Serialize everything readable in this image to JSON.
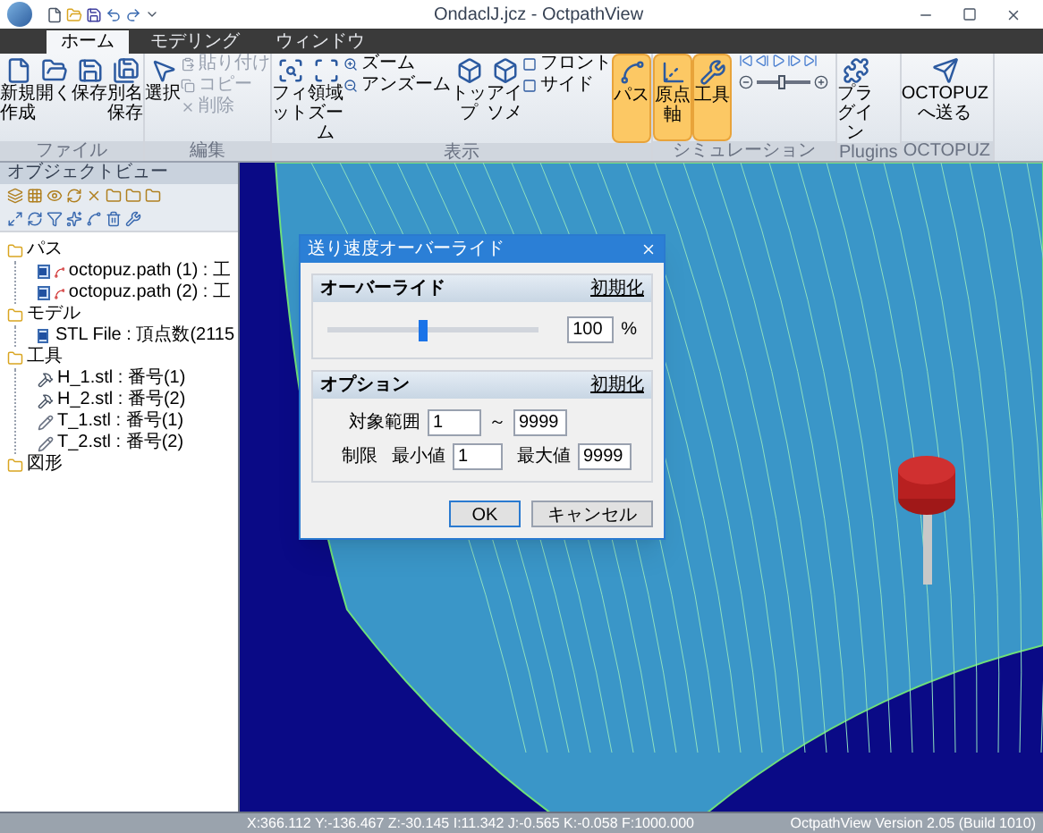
{
  "window": {
    "title": "OndaclJ.jcz - OctpathView"
  },
  "tabs": [
    {
      "label": "ホーム",
      "selected": true
    },
    {
      "label": "モデリング",
      "selected": false
    },
    {
      "label": "ウィンドウ",
      "selected": false
    }
  ],
  "ribbon": {
    "groups": [
      {
        "label": "ファイル",
        "items": [
          {
            "kind": "large",
            "label": "新規作成",
            "on": false
          },
          {
            "kind": "large",
            "label": "開く",
            "on": false
          },
          {
            "kind": "large",
            "label": "保存",
            "on": false
          },
          {
            "kind": "large",
            "label": "別名保存",
            "on": false
          }
        ]
      },
      {
        "label": "編集",
        "items": [
          {
            "kind": "large",
            "label": "選択",
            "on": false
          },
          {
            "kind": "small",
            "label": "貼り付け",
            "disabled": true
          },
          {
            "kind": "small",
            "label": "コピー",
            "disabled": true
          },
          {
            "kind": "small",
            "label": "削除",
            "disabled": true
          }
        ]
      },
      {
        "label": "表示",
        "items": [
          {
            "kind": "large",
            "label": "フィット",
            "on": false
          },
          {
            "kind": "large",
            "label": "領域ズーム",
            "on": false
          },
          {
            "kind": "small",
            "label": "ズーム",
            "disabled": false
          },
          {
            "kind": "small",
            "label": "アンズーム",
            "disabled": false
          },
          {
            "kind": "large",
            "label": "トップ",
            "on": false
          },
          {
            "kind": "large",
            "label": "アイソメ",
            "on": false
          },
          {
            "kind": "small",
            "label": "フロント",
            "disabled": false
          },
          {
            "kind": "small",
            "label": "サイド",
            "disabled": false
          },
          {
            "kind": "large",
            "label": "パス",
            "on": true
          }
        ]
      },
      {
        "label": "シミュレーション",
        "items": [
          {
            "kind": "large",
            "label": "原点軸",
            "on": true
          },
          {
            "kind": "large",
            "label": "工具",
            "on": true
          },
          {
            "kind": "player",
            "level": 0.45
          }
        ]
      },
      {
        "label": "Plugins",
        "items": [
          {
            "kind": "large",
            "label": "プラグイン",
            "on": false
          }
        ]
      },
      {
        "label": "OCTOPUZ",
        "items": [
          {
            "kind": "large",
            "label": "OCTOPUZへ送る",
            "on": false
          }
        ]
      }
    ]
  },
  "object_view": {
    "title": "オブジェクトビュー",
    "tree": [
      {
        "kind": "folder",
        "label": "パス",
        "children": [
          {
            "kind": "path",
            "label": "octopuz.path (1) : 工",
            "checked": true
          },
          {
            "kind": "path",
            "label": "octopuz.path (2) : 工",
            "checked": true
          }
        ]
      },
      {
        "kind": "folder",
        "label": "モデル",
        "children": [
          {
            "kind": "model",
            "label": "STL File : 頂点数(2115",
            "checked": true
          }
        ]
      },
      {
        "kind": "folder",
        "label": "工具",
        "children": [
          {
            "kind": "holder",
            "label": "H_1.stl : 番号(1)"
          },
          {
            "kind": "holder",
            "label": "H_2.stl : 番号(2)"
          },
          {
            "kind": "tool",
            "label": "T_1.stl : 番号(1)"
          },
          {
            "kind": "tool",
            "label": "T_2.stl : 番号(2)"
          }
        ]
      },
      {
        "kind": "folder",
        "label": "図形"
      }
    ]
  },
  "dialog": {
    "title": "送り速度オーバーライド",
    "override": {
      "heading": "オーバーライド",
      "reset": "初期化",
      "level": 0.43,
      "value": "100",
      "unit": "%"
    },
    "options": {
      "heading": "オプション",
      "reset": "初期化",
      "range_label": "対象範囲",
      "range_from": "1",
      "range_sep": "～",
      "range_to": "9999",
      "limit_label": "制限",
      "min_label": "最小値",
      "min_value": "1",
      "max_label": "最大値",
      "max_value": "9999"
    },
    "buttons": [
      {
        "label": "OK",
        "selected": true
      },
      {
        "label": "キャンセル",
        "selected": false
      }
    ]
  },
  "status_bar": {
    "coords": "X:366.112 Y:-136.467 Z:-30.145 I:11.342 J:-0.565 K:-0.058 F:1000.000",
    "version": "OctpathView Version 2.05 (Build 1010)"
  }
}
